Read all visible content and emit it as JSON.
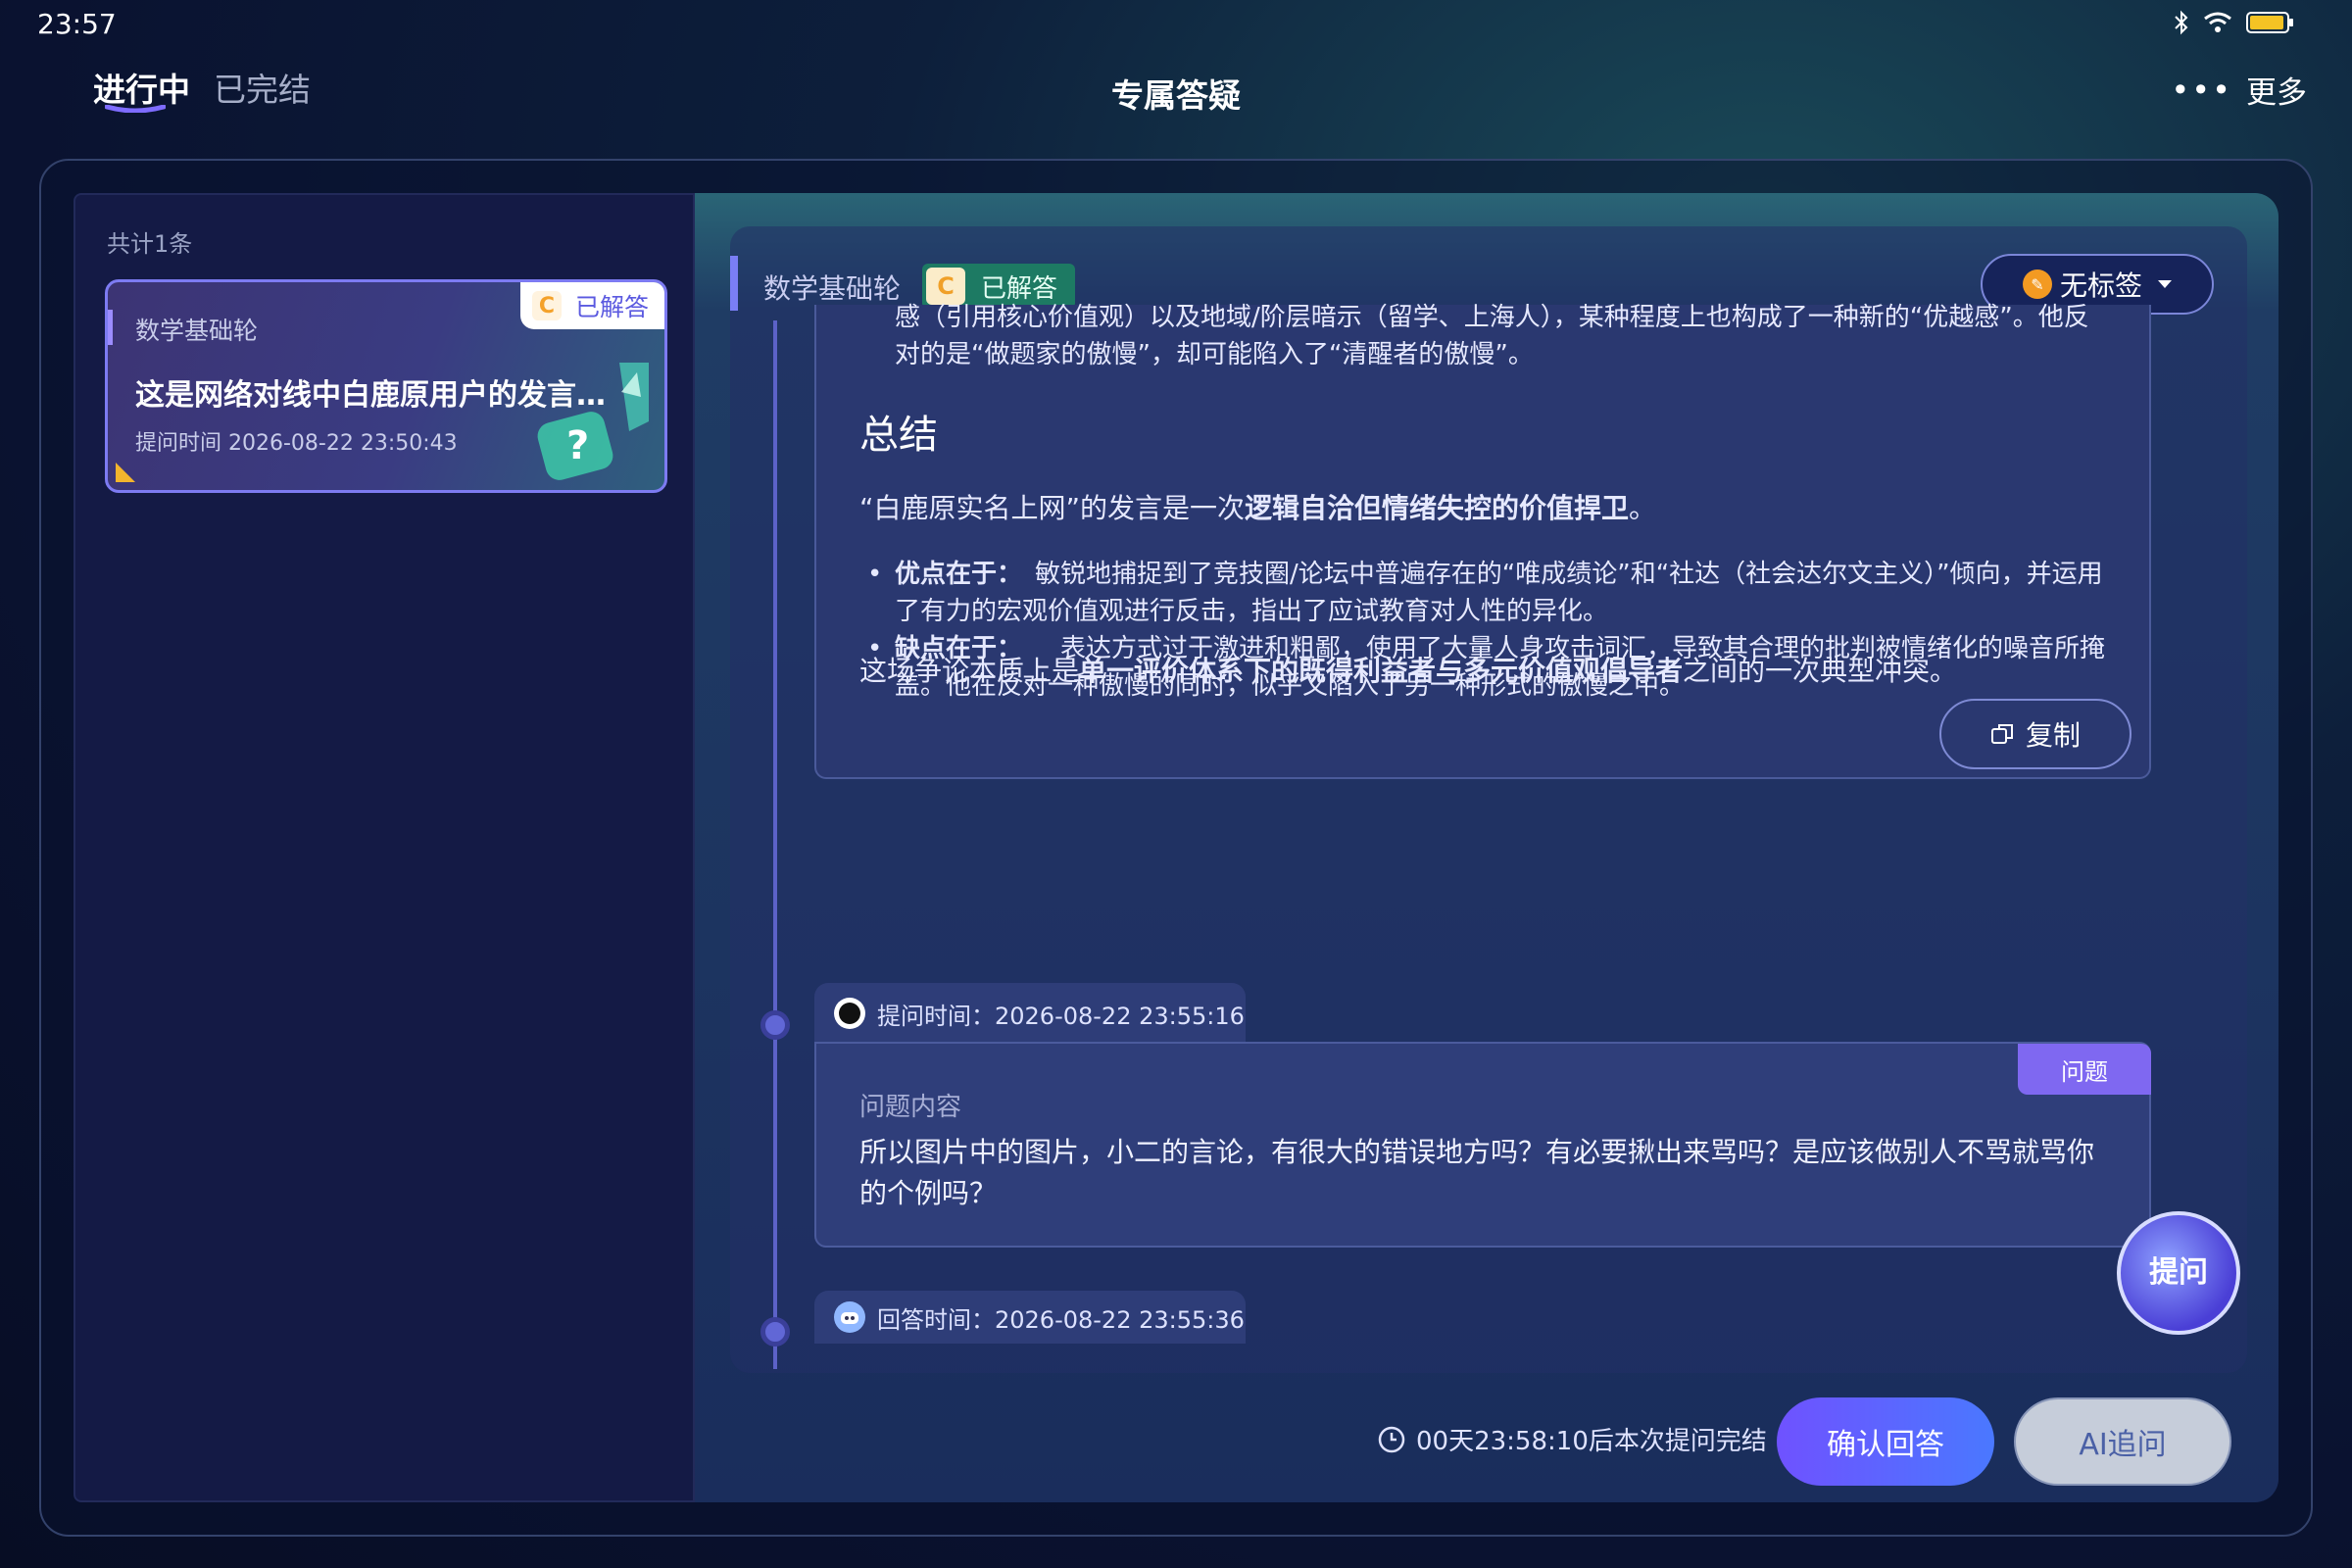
{
  "status_bar": {
    "time": "23:57"
  },
  "nav": {
    "tabs": [
      {
        "label": "进行中"
      },
      {
        "label": "已完结"
      }
    ],
    "title": "专属答疑",
    "more_label": "更多"
  },
  "sidebar": {
    "count_label": "共计1条",
    "card": {
      "subject": "数学基础轮",
      "badge_letter": "C",
      "badge_text": "已解答",
      "title": "这是网络对线中白鹿原用户的发言，…",
      "time": "提问时间 2026-08-22 23:50:43"
    }
  },
  "detail": {
    "subject": "数学基础轮",
    "badge_letter": "C",
    "badge_text": "已解答",
    "tag_button": "无标签",
    "answer": {
      "line1a": "感（引用核心价值观）以及地域/阶层暗示（留学、上海人），某种程度上也构成了一种新的“优越感”。他反",
      "line1b": "对的是“做题家的傲慢”，却可能陷入了“清醒者的傲慢”。",
      "heading": "总结",
      "p1_pre": "“白鹿原实名上网”的发言是一次",
      "p1_bold": "逻辑自洽但情绪失控的价值捍卫",
      "p1_post": "。",
      "bullet1_bold": "优点在于：",
      "bullet1_text": "　敏锐地捕捉到了竞技圈/论坛中普遍存在的“唯成绩论”和“社达（社会达尔文主义）”倾向，并运用了有力的宏观价值观进行反击，指出了应试教育对人性的异化。",
      "bullet2_bold": "缺点在于：",
      "bullet2_text": "　　表达方式过于激进和粗鄙，使用了大量人身攻击词汇，导致其合理的批判被情绪化的噪音所掩盖。他在反对一种傲慢的同时，似乎又陷入了另一种形式的傲慢之中。",
      "p2_pre": "这场争论本质上是",
      "p2_bold": "单一评价体系下的既得利益者与多元价值观倡导者",
      "p2_post": "之间的一次典型冲突。",
      "copy_label": "复制"
    },
    "question": {
      "time_label": "提问时间：2026-08-22 23:55:16",
      "tag": "问题",
      "content_label": "问题内容",
      "content": "所以图片中的图片，小二的言论，有很大的错误地方吗？有必要揪出来骂吗？是应该做别人不骂就骂你的个例吗？"
    },
    "reply": {
      "time_label": "回答时间：2026-08-22 23:55:36"
    },
    "float_button": "提问"
  },
  "footer": {
    "countdown": "00天23:58:10后本次提问完结",
    "confirm_label": "确认回答",
    "ai_label": "AI追问"
  }
}
